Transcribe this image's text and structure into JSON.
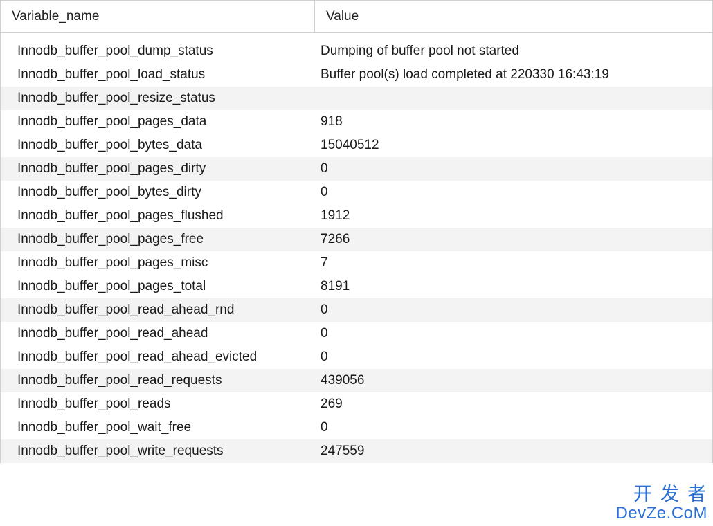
{
  "table": {
    "headers": {
      "name": "Variable_name",
      "value": "Value"
    },
    "rows": [
      {
        "name": "Innodb_buffer_pool_dump_status",
        "value": "Dumping of buffer pool not started",
        "striped": false
      },
      {
        "name": "Innodb_buffer_pool_load_status",
        "value": "Buffer pool(s) load completed at 220330 16:43:19",
        "striped": false
      },
      {
        "name": "Innodb_buffer_pool_resize_status",
        "value": "",
        "striped": true
      },
      {
        "name": "Innodb_buffer_pool_pages_data",
        "value": "918",
        "striped": false
      },
      {
        "name": "Innodb_buffer_pool_bytes_data",
        "value": "15040512",
        "striped": false
      },
      {
        "name": "Innodb_buffer_pool_pages_dirty",
        "value": "0",
        "striped": true
      },
      {
        "name": "Innodb_buffer_pool_bytes_dirty",
        "value": "0",
        "striped": false
      },
      {
        "name": "Innodb_buffer_pool_pages_flushed",
        "value": "1912",
        "striped": false
      },
      {
        "name": "Innodb_buffer_pool_pages_free",
        "value": "7266",
        "striped": true
      },
      {
        "name": "Innodb_buffer_pool_pages_misc",
        "value": "7",
        "striped": false
      },
      {
        "name": "Innodb_buffer_pool_pages_total",
        "value": "8191",
        "striped": false
      },
      {
        "name": "Innodb_buffer_pool_read_ahead_rnd",
        "value": "0",
        "striped": true
      },
      {
        "name": "Innodb_buffer_pool_read_ahead",
        "value": "0",
        "striped": false
      },
      {
        "name": "Innodb_buffer_pool_read_ahead_evicted",
        "value": "0",
        "striped": false
      },
      {
        "name": "Innodb_buffer_pool_read_requests",
        "value": "439056",
        "striped": true
      },
      {
        "name": "Innodb_buffer_pool_reads",
        "value": "269",
        "striped": false
      },
      {
        "name": "Innodb_buffer_pool_wait_free",
        "value": "0",
        "striped": false
      },
      {
        "name": "Innodb_buffer_pool_write_requests",
        "value": "247559",
        "striped": true
      }
    ]
  },
  "watermark": {
    "line1": "开发者",
    "line2": "DevZe.CoM"
  }
}
